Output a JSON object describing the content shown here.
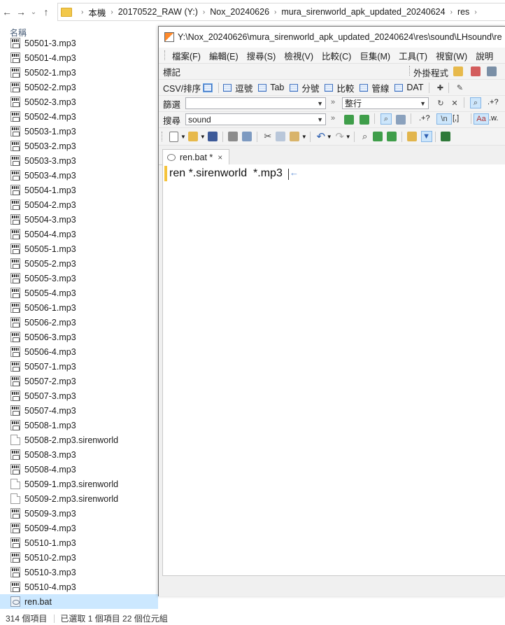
{
  "address": {
    "crumbs": [
      "本機",
      "20170522_RAW (Y:)",
      "Nox_20240626",
      "mura_sirenworld_apk_updated_20240624",
      "res"
    ]
  },
  "explorer": {
    "column_header": "名稱",
    "files": [
      {
        "name": "50501-3.mp3",
        "type": "mp3"
      },
      {
        "name": "50501-4.mp3",
        "type": "mp3"
      },
      {
        "name": "50502-1.mp3",
        "type": "mp3"
      },
      {
        "name": "50502-2.mp3",
        "type": "mp3"
      },
      {
        "name": "50502-3.mp3",
        "type": "mp3"
      },
      {
        "name": "50502-4.mp3",
        "type": "mp3"
      },
      {
        "name": "50503-1.mp3",
        "type": "mp3"
      },
      {
        "name": "50503-2.mp3",
        "type": "mp3"
      },
      {
        "name": "50503-3.mp3",
        "type": "mp3"
      },
      {
        "name": "50503-4.mp3",
        "type": "mp3"
      },
      {
        "name": "50504-1.mp3",
        "type": "mp3"
      },
      {
        "name": "50504-2.mp3",
        "type": "mp3"
      },
      {
        "name": "50504-3.mp3",
        "type": "mp3"
      },
      {
        "name": "50504-4.mp3",
        "type": "mp3"
      },
      {
        "name": "50505-1.mp3",
        "type": "mp3"
      },
      {
        "name": "50505-2.mp3",
        "type": "mp3"
      },
      {
        "name": "50505-3.mp3",
        "type": "mp3"
      },
      {
        "name": "50505-4.mp3",
        "type": "mp3"
      },
      {
        "name": "50506-1.mp3",
        "type": "mp3"
      },
      {
        "name": "50506-2.mp3",
        "type": "mp3"
      },
      {
        "name": "50506-3.mp3",
        "type": "mp3"
      },
      {
        "name": "50506-4.mp3",
        "type": "mp3"
      },
      {
        "name": "50507-1.mp3",
        "type": "mp3"
      },
      {
        "name": "50507-2.mp3",
        "type": "mp3"
      },
      {
        "name": "50507-3.mp3",
        "type": "mp3"
      },
      {
        "name": "50507-4.mp3",
        "type": "mp3"
      },
      {
        "name": "50508-1.mp3",
        "type": "mp3"
      },
      {
        "name": "50508-2.mp3.sirenworld",
        "type": "blank"
      },
      {
        "name": "50508-3.mp3",
        "type": "mp3"
      },
      {
        "name": "50508-4.mp3",
        "type": "mp3"
      },
      {
        "name": "50509-1.mp3.sirenworld",
        "type": "blank"
      },
      {
        "name": "50509-2.mp3.sirenworld",
        "type": "blank"
      },
      {
        "name": "50509-3.mp3",
        "type": "mp3"
      },
      {
        "name": "50509-4.mp3",
        "type": "mp3"
      },
      {
        "name": "50510-1.mp3",
        "type": "mp3"
      },
      {
        "name": "50510-2.mp3",
        "type": "mp3"
      },
      {
        "name": "50510-3.mp3",
        "type": "mp3"
      },
      {
        "name": "50510-4.mp3",
        "type": "mp3"
      },
      {
        "name": "ren.bat",
        "type": "bat",
        "selected": true
      }
    ]
  },
  "status": {
    "count": "314 個項目",
    "selection": "已選取 1 個項目  22 個位元組"
  },
  "editor": {
    "title": "Y:\\Nox_20240626\\mura_sirenworld_apk_updated_20240624\\res\\sound\\LHsound\\re",
    "menu": [
      "檔案(F)",
      "編輯(E)",
      "搜尋(S)",
      "檢視(V)",
      "比較(C)",
      "巨集(M)",
      "工具(T)",
      "視窗(W)",
      "說明"
    ],
    "bookmark_label": "標記",
    "plugin_label": "外掛程式",
    "csv_label": "CSV/排序",
    "csv_modes": [
      "逗號",
      "Tab",
      "分號",
      "比較",
      "管線",
      "DAT"
    ],
    "filter_label": "篩選",
    "filter_value": "",
    "filter_mode": "整行",
    "regex_label": ".+?",
    "search_label": "搜尋",
    "search_value": "sound",
    "newline_label": "\\n",
    "bracket_label": "[,]",
    "case_label": "Aa",
    "word_label": ".w.",
    "tab_label": "ren.bat *",
    "tab_close": "×",
    "content": "ren *.sirenworld  *.mp3"
  }
}
